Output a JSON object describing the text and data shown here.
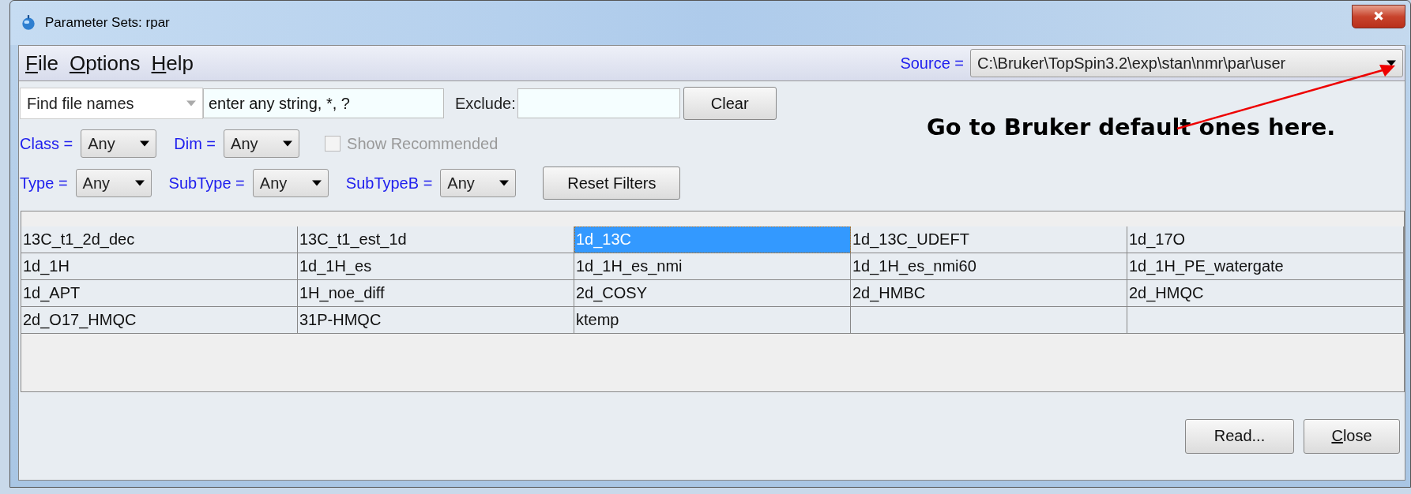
{
  "window": {
    "title": "Parameter Sets: rpar"
  },
  "menu": [
    {
      "mnemonic": "F",
      "rest": "ile"
    },
    {
      "mnemonic": "O",
      "rest": "ptions"
    },
    {
      "mnemonic": "H",
      "rest": "elp"
    }
  ],
  "source": {
    "label": "Source =",
    "value": "C:\\Bruker\\TopSpin3.2\\exp\\stan\\nmr\\par\\user"
  },
  "search": {
    "mode": "Find file names",
    "placeholder": "enter any string, *, ?",
    "exclude_label": "Exclude:",
    "clear_button": "Clear"
  },
  "filters": [
    [
      {
        "label": "Class =",
        "value": "Any"
      },
      {
        "label": "Dim =",
        "value": "Any"
      }
    ],
    [
      {
        "label": "Type =",
        "value": "Any"
      },
      {
        "label": "SubType =",
        "value": "Any"
      },
      {
        "label": "SubTypeB =",
        "value": "Any"
      }
    ]
  ],
  "show_recommended": {
    "label": "Show Recommended",
    "checked": false,
    "disabled": true
  },
  "reset_button": "Reset Filters",
  "table": {
    "rows": [
      [
        {
          "text": "13C_t1_2d_dec",
          "selected": false
        },
        {
          "text": "13C_t1_est_1d",
          "selected": false
        },
        {
          "text": "1d_13C",
          "selected": true
        },
        {
          "text": "1d_13C_UDEFT",
          "selected": false
        },
        {
          "text": "1d_17O",
          "selected": false
        }
      ],
      [
        {
          "text": "1d_1H",
          "selected": false
        },
        {
          "text": "1d_1H_es",
          "selected": false
        },
        {
          "text": "1d_1H_es_nmi",
          "selected": false
        },
        {
          "text": "1d_1H_es_nmi60",
          "selected": false
        },
        {
          "text": "1d_1H_PE_watergate",
          "selected": false
        }
      ],
      [
        {
          "text": "1d_APT",
          "selected": false
        },
        {
          "text": "1H_noe_diff",
          "selected": false
        },
        {
          "text": "2d_COSY",
          "selected": false
        },
        {
          "text": "2d_HMBC",
          "selected": false
        },
        {
          "text": "2d_HMQC",
          "selected": false
        }
      ],
      [
        {
          "text": "2d_O17_HMQC",
          "selected": false
        },
        {
          "text": "31P-HMQC",
          "selected": false
        },
        {
          "text": "ktemp",
          "selected": false
        }
      ]
    ]
  },
  "buttons": [
    {
      "text": "Read..."
    },
    {
      "mnemonic": "C",
      "rest": "lose"
    }
  ],
  "annotation": {
    "text": "Go to Bruker default ones here."
  }
}
